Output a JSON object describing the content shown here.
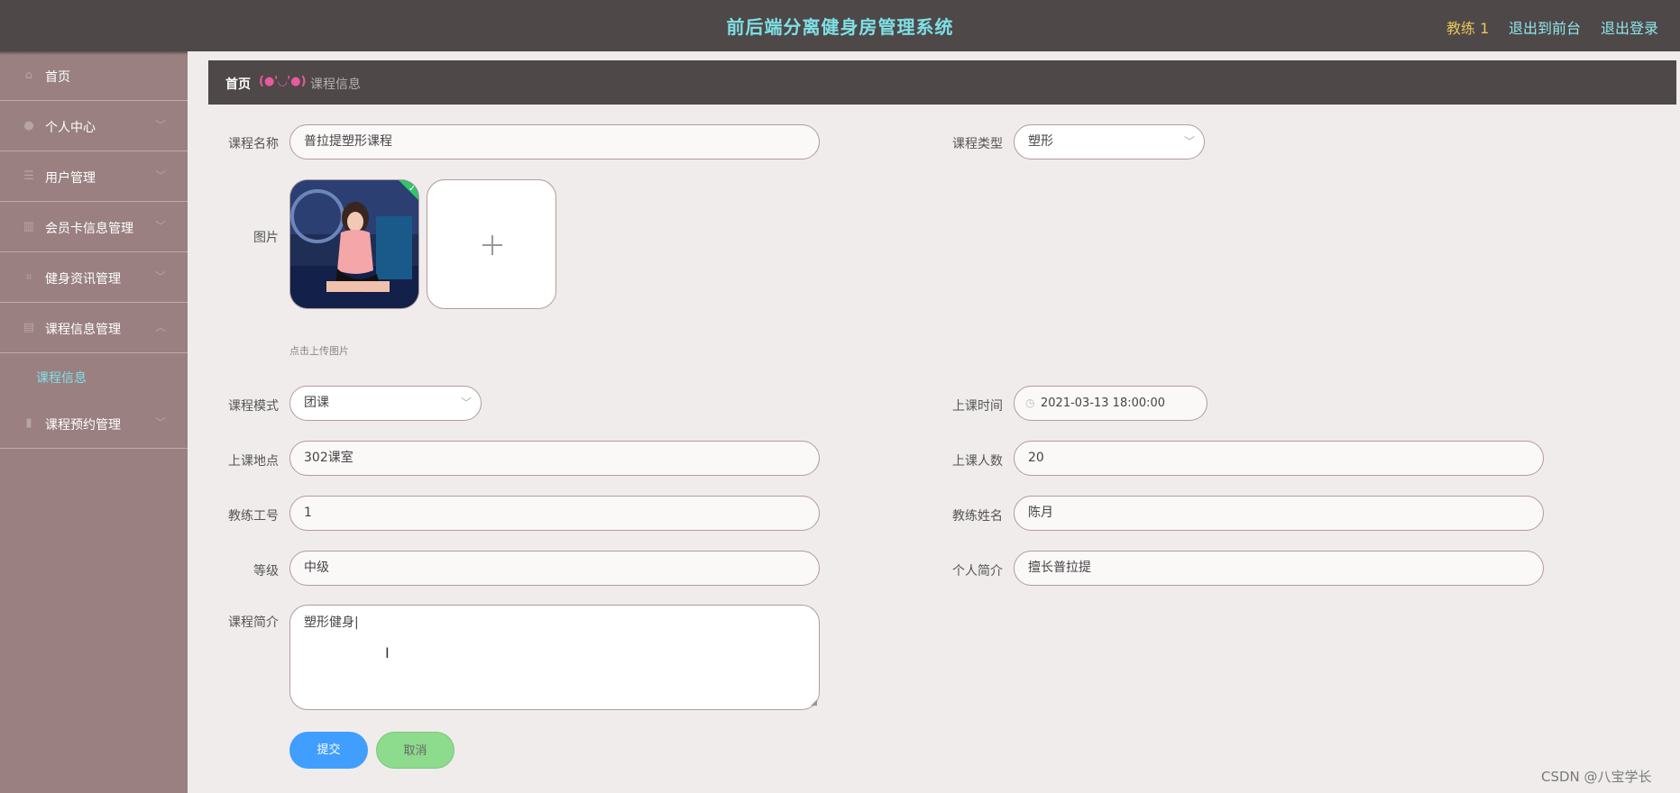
{
  "header": {
    "title": "前后端分离健身房管理系统",
    "user": "教练 1",
    "to_front": "退出到前台",
    "logout": "退出登录"
  },
  "sidebar": {
    "items": [
      {
        "label": "首页",
        "icon": "home-icon"
      },
      {
        "label": "个人中心",
        "icon": "user-icon"
      },
      {
        "label": "用户管理",
        "icon": "list-icon"
      },
      {
        "label": "会员卡信息管理",
        "icon": "card-icon"
      },
      {
        "label": "健身资讯管理",
        "icon": "news-icon"
      },
      {
        "label": "课程信息管理",
        "icon": "briefcase-icon"
      },
      {
        "label": "课程预约管理",
        "icon": "chart-icon"
      }
    ],
    "sub_item": "课程信息"
  },
  "breadcrumb": {
    "home": "首页",
    "face": "(●'◡'●)",
    "current": "课程信息"
  },
  "form": {
    "course_name_label": "课程名称",
    "course_name": "普拉提塑形课程",
    "course_type_label": "课程类型",
    "course_type": "塑形",
    "image_label": "图片",
    "upload_hint": "点击上传图片",
    "mode_label": "课程模式",
    "mode": "团课",
    "time_label": "上课时间",
    "time": "2021-03-13 18:00:00",
    "place_label": "上课地点",
    "place": "302课室",
    "count_label": "上课人数",
    "count": "20",
    "coach_no_label": "教练工号",
    "coach_no": "1",
    "coach_name_label": "教练姓名",
    "coach_name": "陈月",
    "level_label": "等级",
    "level": "中级",
    "intro_label": "个人简介",
    "intro": "擅长普拉提",
    "course_intro_label": "课程简介",
    "course_intro": "塑形健身|",
    "submit": "提交",
    "cancel": "取消"
  },
  "watermark": "CSDN @八宝学长"
}
